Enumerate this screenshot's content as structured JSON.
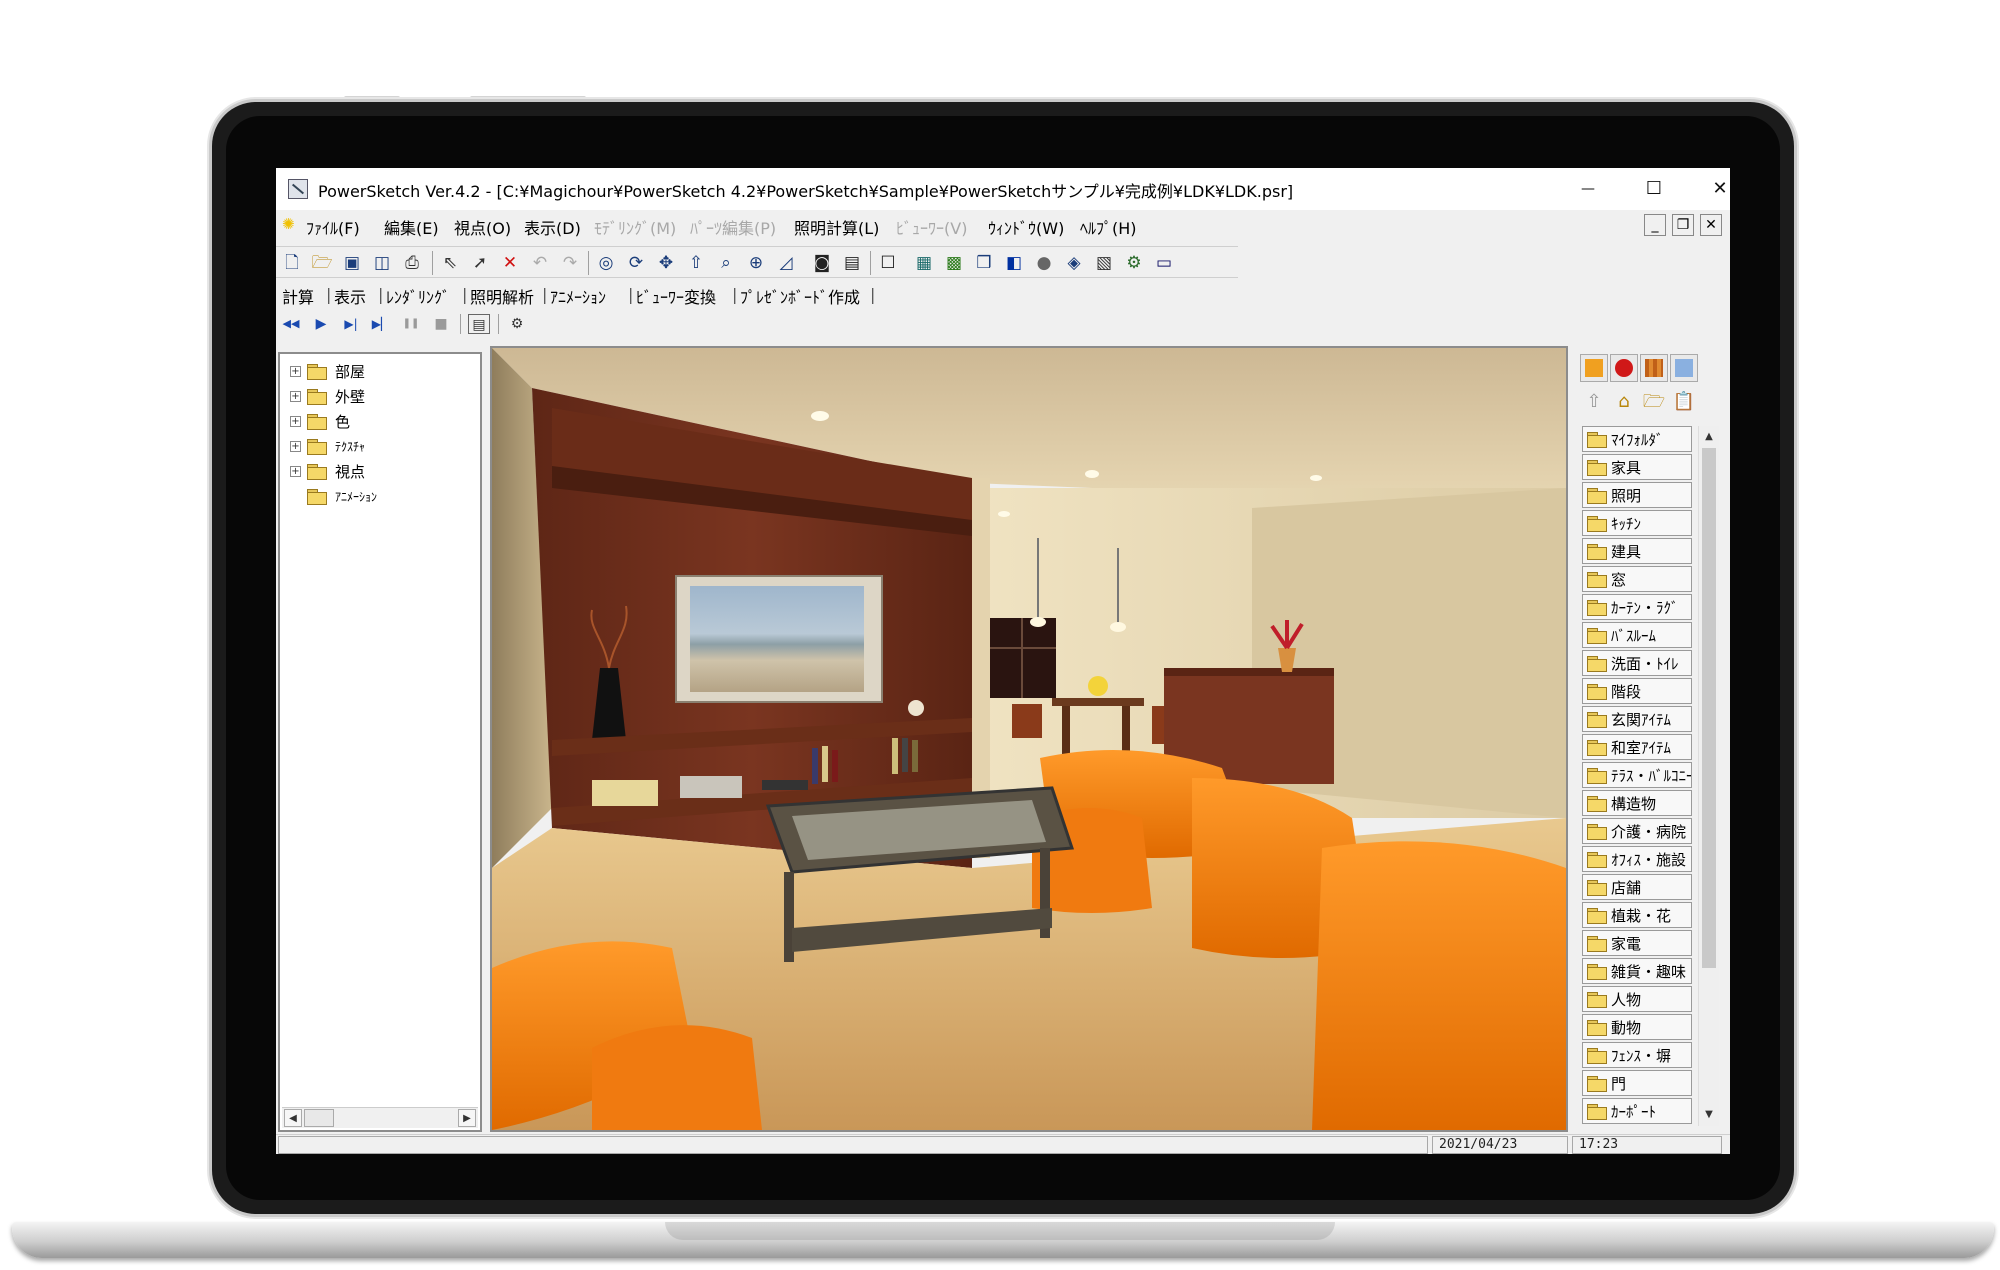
{
  "window": {
    "title": "PowerSketch Ver.4.2 - [C:¥Magichour¥PowerSketch 4.2¥PowerSketch¥Sample¥PowerSketchサンプル¥完成例¥LDK¥LDK.psr]",
    "minimize_glyph": "—",
    "maximize_glyph": "☐",
    "close_glyph": "✕"
  },
  "menubar": {
    "items": [
      {
        "label": "ﾌｧｲﾙ(F)",
        "enabled": true
      },
      {
        "label": "編集(E)",
        "enabled": true
      },
      {
        "label": "視点(O)",
        "enabled": true
      },
      {
        "label": "表示(D)",
        "enabled": true
      },
      {
        "label": "ﾓﾃﾞﾘﾝｸﾞ(M)",
        "enabled": false
      },
      {
        "label": "ﾊﾟｰﾂ編集(P)",
        "enabled": false
      },
      {
        "label": "照明計算(L)",
        "enabled": true
      },
      {
        "label": "ﾋﾞｭｰﾜｰ(V)",
        "enabled": false
      },
      {
        "label": "ｳｨﾝﾄﾞｳ(W)",
        "enabled": true
      },
      {
        "label": "ﾍﾙﾌﾟ(H)",
        "enabled": true
      }
    ],
    "mdi_minimize": "_",
    "mdi_restore": "❐",
    "mdi_close": "✕"
  },
  "toolbar": {
    "icons": [
      "new-file-icon",
      "open-folder-icon",
      "save-icon",
      "save-all-icon",
      "print-icon",
      "select-arrow-icon",
      "select-parts-icon",
      "delete-icon",
      "undo-icon",
      "redo-icon",
      "orbit-icon",
      "rotate-view-icon",
      "pan-icon",
      "move-up-icon",
      "zoom-icon",
      "move-cross-icon",
      "perspective-icon",
      "camera-icon",
      "camera-settings-icon",
      "frame-icon",
      "box-icon",
      "grid-icon",
      "window-icon",
      "layer-icon",
      "sphere-icon",
      "render-icon",
      "light-icon",
      "settings-icon",
      "monitor-icon"
    ]
  },
  "tabs": [
    "計算",
    "表示",
    "ﾚﾝﾀﾞﾘﾝｸﾞ",
    "照明解析",
    "ｱﾆﾒｰｼｮﾝ",
    "ﾋﾞｭｰﾜｰ変換",
    "ﾌﾟﾚｾﾞﾝﾎﾞｰﾄﾞ作成"
  ],
  "playback": {
    "rewind": "◀◀",
    "play": "▶",
    "step": "▶|",
    "end": "▶▏",
    "pause": "❚❚",
    "stop": "■"
  },
  "tree": {
    "items": [
      {
        "label": "部屋",
        "expandable": true
      },
      {
        "label": "外壁",
        "expandable": true
      },
      {
        "label": "色",
        "expandable": true
      },
      {
        "label": "ﾃｸｽﾁｬ",
        "expandable": true
      },
      {
        "label": "視点",
        "expandable": true
      },
      {
        "label": "ｱﾆﾒｰｼｮﾝ",
        "expandable": false
      }
    ],
    "expander_glyph": "+",
    "scroll_left": "◀",
    "scroll_right": "▶"
  },
  "parts": {
    "items": [
      "ﾏｲﾌｫﾙﾀﾞ",
      "家具",
      "照明",
      "ｷｯﾁﾝ",
      "建具",
      "窓",
      "ｶｰﾃﾝ・ﾗｸﾞ",
      "ﾊﾞｽﾙｰﾑ",
      "洗面・ﾄｲﾚ",
      "階段",
      "玄関ｱｲﾃﾑ",
      "和室ｱｲﾃﾑ",
      "ﾃﾗｽ・ﾊﾞﾙｺﾆｰ",
      "構造物",
      "介護・病院",
      "ｵﾌｨｽ・施設",
      "店舗",
      "植栽・花",
      "家電",
      "雑貨・趣味",
      "人物",
      "動物",
      "ﾌｪﾝｽ・塀",
      "門",
      "ｶｰﾎﾟｰﾄ"
    ],
    "scroll_up": "▲",
    "scroll_down": "▼"
  },
  "status": {
    "date": "2021/04/23",
    "time": "17:23"
  }
}
